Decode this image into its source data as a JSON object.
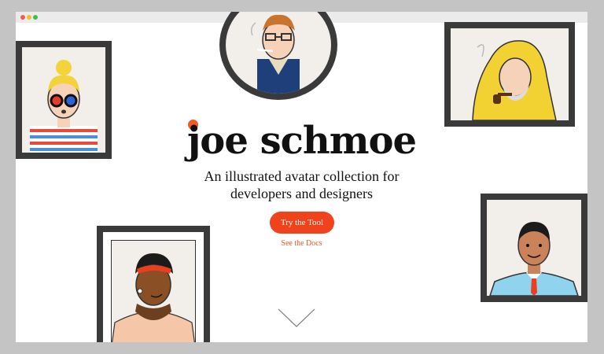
{
  "window": {
    "controls": [
      "close",
      "minimize",
      "maximize"
    ]
  },
  "hero": {
    "title": "joe schmoe",
    "tagline_line1": "An illustrated avatar collection for",
    "tagline_line2": "developers and designers",
    "primary_button": "Try the Tool",
    "secondary_link": "See the Docs"
  },
  "colors": {
    "accent": "#f0431b",
    "frame": "#3a3a3a",
    "canvas": "#f2eee9"
  },
  "avatars": [
    {
      "name": "hipster-with-glasses",
      "frame": "circle"
    },
    {
      "name": "girl-with-sunglasses",
      "frame": "square"
    },
    {
      "name": "fisherman-with-pipe",
      "frame": "square"
    },
    {
      "name": "man-with-tie",
      "frame": "square"
    },
    {
      "name": "woman-with-headscarf",
      "frame": "square"
    }
  ],
  "icons": {
    "scroll_hint": "chevron-down-icon"
  }
}
